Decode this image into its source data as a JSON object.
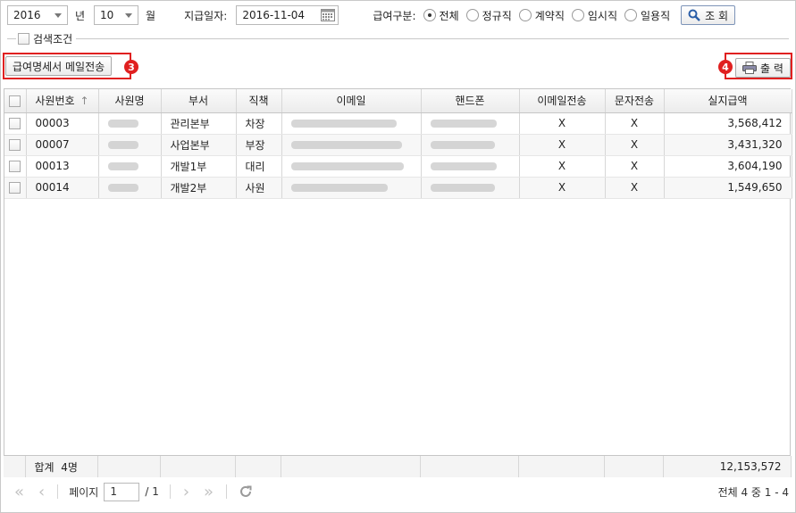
{
  "filter": {
    "year": "2016",
    "year_unit": "년",
    "month": "10",
    "month_unit": "월",
    "pay_date_label": "지급일자:",
    "pay_date": "2016-11-04",
    "pay_type_label": "급여구분:",
    "pay_types": [
      "전체",
      "정규직",
      "계약직",
      "임시직",
      "일용직"
    ],
    "pay_type_selected": "전체",
    "search_label": "조 회"
  },
  "search_condition": {
    "label": "검색조건"
  },
  "actions": {
    "mail_button": "급여명세서 메일전송",
    "mail_badge": "3",
    "print_button": "출 력",
    "print_badge": "4"
  },
  "grid": {
    "columns": [
      "사원번호",
      "사원명",
      "부서",
      "직책",
      "이메일",
      "핸드폰",
      "이메일전송",
      "문자전송",
      "실지급액"
    ],
    "rows": [
      {
        "emp_no": "00003",
        "dept": "관리본부",
        "position": "차장",
        "email_sent": "X",
        "sms_sent": "X",
        "net_pay": "3,568,412"
      },
      {
        "emp_no": "00007",
        "dept": "사업본부",
        "position": "부장",
        "email_sent": "X",
        "sms_sent": "X",
        "net_pay": "3,431,320"
      },
      {
        "emp_no": "00013",
        "dept": "개발1부",
        "position": "대리",
        "email_sent": "X",
        "sms_sent": "X",
        "net_pay": "3,604,190"
      },
      {
        "emp_no": "00014",
        "dept": "개발2부",
        "position": "사원",
        "email_sent": "X",
        "sms_sent": "X",
        "net_pay": "1,549,650"
      }
    ],
    "summary_label": "합계",
    "summary_count": "4명",
    "summary_total": "12,153,572"
  },
  "pager": {
    "page_label": "페이지",
    "page": "1",
    "page_total": "/ 1",
    "total_text": "전체 4 중 1 - 4"
  }
}
